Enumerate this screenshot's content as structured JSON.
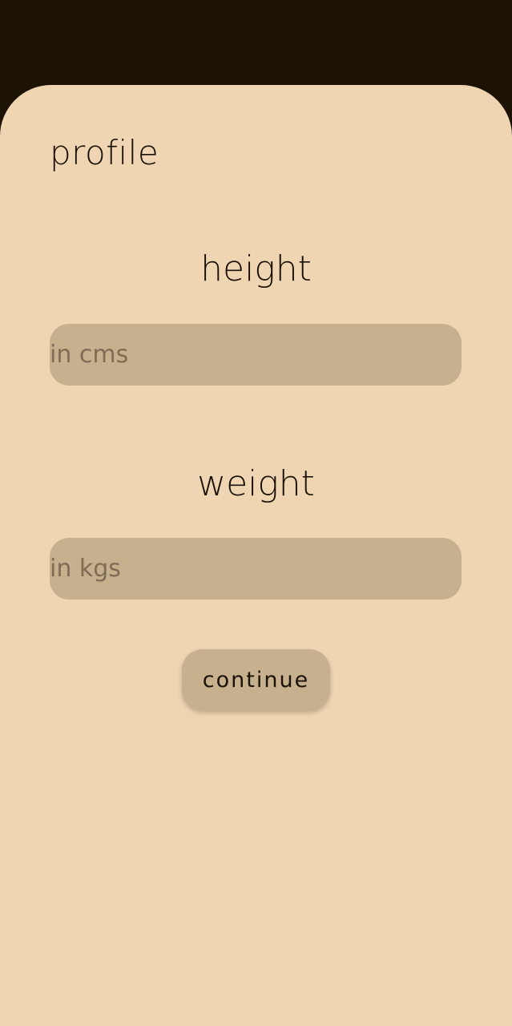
{
  "colors": {
    "backdrop": "#1d1304",
    "sheet": "#efd5b1",
    "control": "#c7b08e",
    "text": "#1b1206",
    "placeholder": "#7e6c55"
  },
  "page": {
    "title": "profile"
  },
  "height": {
    "label": "height",
    "placeholder": "in cms",
    "value": ""
  },
  "weight": {
    "label": "weight",
    "placeholder": "in kgs",
    "value": ""
  },
  "actions": {
    "continue_label": "continue"
  }
}
